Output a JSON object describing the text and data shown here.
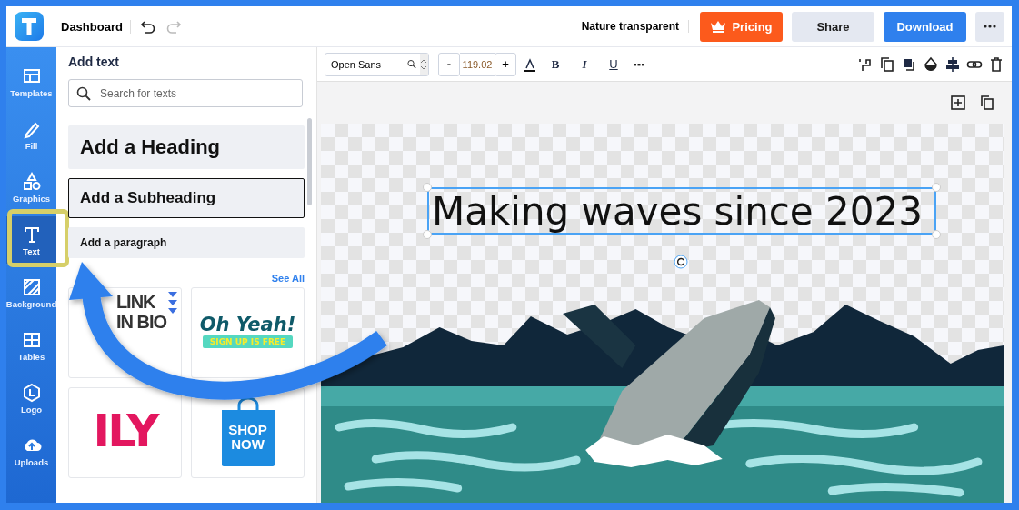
{
  "header": {
    "title": "Dashboard",
    "document_name": "Nature transparent",
    "buttons": [
      {
        "label": "Pricing",
        "kind": "pricing"
      },
      {
        "label": "Share",
        "kind": "secondary"
      },
      {
        "label": "Download",
        "kind": "primary"
      }
    ]
  },
  "sidebar": {
    "items": [
      {
        "label": "Templates",
        "selected": false
      },
      {
        "label": "Fill",
        "selected": false
      },
      {
        "label": "Graphics",
        "selected": false
      },
      {
        "label": "Text",
        "selected": true
      },
      {
        "label": "Background",
        "selected": false
      },
      {
        "label": "Tables",
        "selected": false
      },
      {
        "label": "Logo",
        "selected": false
      },
      {
        "label": "Uploads",
        "selected": false
      }
    ]
  },
  "panel": {
    "title": "Add text",
    "search": {
      "placeholder": "Search for texts"
    },
    "text_styles": [
      {
        "label": "Add a Heading",
        "kind": "heading",
        "selected": false
      },
      {
        "label": "Add a Subheading",
        "kind": "subheading",
        "selected": true
      },
      {
        "label": "Add a paragraph",
        "kind": "paragraph",
        "selected": false
      }
    ],
    "section_link": "See All",
    "stickers": [
      {
        "kind": "link-in-bio",
        "lines": [
          "LINK",
          "IN BIO"
        ]
      },
      {
        "kind": "oh-yeah",
        "lines": [
          "Oh Yeah!",
          "SIGN UP IS FREE"
        ]
      },
      {
        "kind": "ily",
        "lines": [
          "ILY"
        ]
      },
      {
        "kind": "shop-now",
        "lines": [
          "SHOP",
          "NOW"
        ]
      }
    ]
  },
  "toolbar": {
    "font": "Open Sans",
    "minus": "-",
    "font_size": "119.02",
    "plus": "+",
    "format_buttons": [
      {
        "label": "B",
        "kind": "bold"
      },
      {
        "label": "I",
        "kind": "italic"
      },
      {
        "label": "U",
        "kind": "underline"
      }
    ]
  },
  "canvas": {
    "text": "Making waves since 2023",
    "selected": true
  }
}
